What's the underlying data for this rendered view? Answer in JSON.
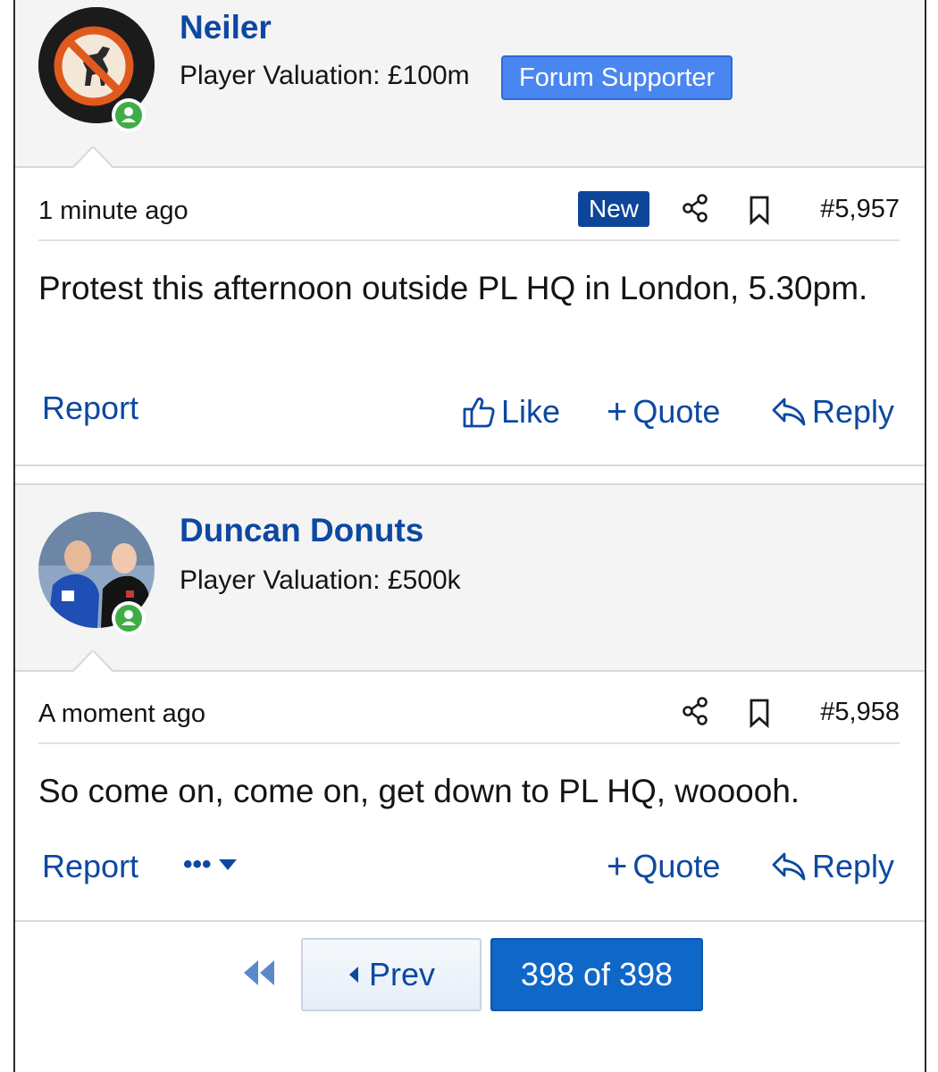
{
  "posts": [
    {
      "username": "Neiler",
      "valuation": "Player Valuation: £100m",
      "badge": "Forum Supporter",
      "avatar_icon": "no-dinosaur-avatar",
      "time": "1 minute ago",
      "new_label": "New",
      "post_number": "#5,957",
      "body": "Protest this afternoon outside PL HQ in London, 5.30pm.",
      "actions": {
        "report": "Report",
        "like": "Like",
        "quote": "Quote",
        "reply": "Reply"
      }
    },
    {
      "username": "Duncan Donuts",
      "valuation": "Player Valuation: £500k",
      "avatar_icon": "footballers-avatar",
      "time": "A moment ago",
      "post_number": "#5,958",
      "body": "So come on, come on, get down to PL HQ, wooooh.",
      "actions": {
        "report": "Report",
        "more": "•••",
        "quote": "Quote",
        "reply": "Reply"
      }
    }
  ],
  "pagination": {
    "prev": "Prev",
    "current": "398 of 398"
  },
  "colors": {
    "link": "#0d48a1",
    "badge": "#4a86f0",
    "new_badge": "#0d4699",
    "online": "#3fad46",
    "page_current": "#0f67c8"
  }
}
